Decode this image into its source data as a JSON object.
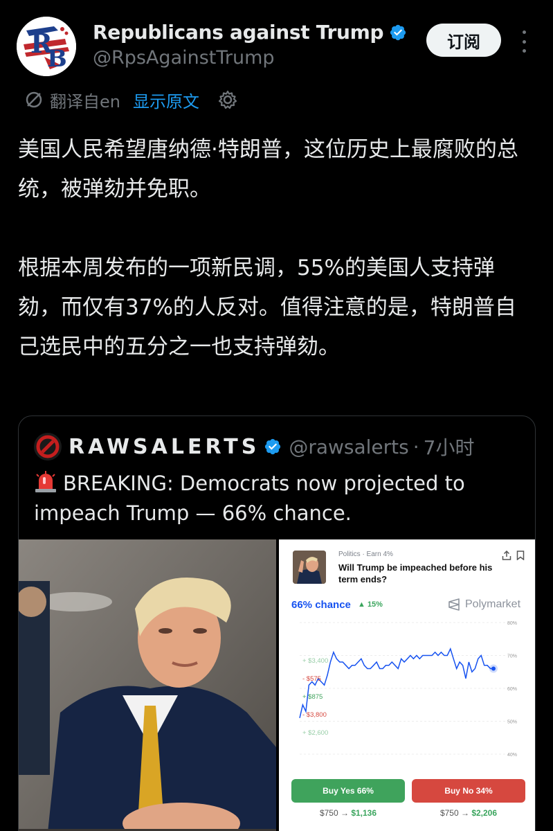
{
  "author": {
    "display_name": "Republicans against Trump",
    "handle": "@RpsAgainstTrump",
    "avatar_text": "RB",
    "subscribe_label": "订阅"
  },
  "translation": {
    "label": "翻译自en",
    "show_original": "显示原文"
  },
  "tweet": {
    "paragraphs": [
      "美国人民希望唐纳德·特朗普，这位历史上最腐败的总统，被弹劾并免职。",
      "根据本周发布的一项新民调，55%的美国人支持弹劾，而仅有37%的人反对。值得注意的是，特朗普自己选民中的五分之一也支持弹劾。"
    ]
  },
  "quote": {
    "name": "RAWSALERTS",
    "handle": "@rawsalerts",
    "separator": "·",
    "time": "7小时",
    "text": "BREAKING: Democrats now projected to impeach Trump — 66% chance."
  },
  "polymarket": {
    "category": "Politics · Earn 4%",
    "question": "Will Trump be impeached before his term ends?",
    "chance": "66% chance",
    "delta": "▲ 15%",
    "brand": "Polymarket",
    "buy_yes": "Buy Yes 66%",
    "buy_no": "Buy No 34%",
    "yes_stake": "$750 →",
    "yes_payout": "$1,136",
    "no_stake": "$750 →",
    "no_payout": "$2,206"
  },
  "colors": {
    "link": "#1d9bf0",
    "verified": "#1d9bf0",
    "pm_blue": "#1652f0",
    "pm_green": "#3fa35c",
    "pm_red": "#d6483f"
  },
  "chart_data": {
    "type": "line",
    "title": "",
    "xlabel": "",
    "ylabel": "",
    "ylim": [
      40,
      80
    ],
    "y_ticks": [
      "80%",
      "70%",
      "60%",
      "50%",
      "40%"
    ],
    "grid": true,
    "series": [
      {
        "values": [
          51,
          55,
          53,
          61,
          62,
          61,
          63,
          62,
          61,
          64,
          68,
          71,
          69,
          68,
          68,
          67,
          66,
          67,
          67,
          68,
          69,
          67,
          66,
          66,
          67,
          68,
          66,
          66,
          67,
          67,
          68,
          67,
          66,
          69,
          68,
          69,
          70,
          69,
          70,
          69,
          70,
          70,
          70,
          70,
          71,
          70,
          71,
          70,
          70,
          72,
          69,
          66,
          68,
          67,
          63,
          68,
          65,
          66,
          69,
          70,
          67,
          67,
          66,
          66
        ]
      }
    ],
    "trade_annotations": [
      {
        "text": "+ $3,400",
        "side": "buy"
      },
      {
        "text": "- $575",
        "side": "sell"
      },
      {
        "text": "+ $875",
        "side": "buy"
      },
      {
        "text": "- $3,800",
        "side": "sell"
      },
      {
        "text": "+ $2,600",
        "side": "buy"
      }
    ]
  }
}
